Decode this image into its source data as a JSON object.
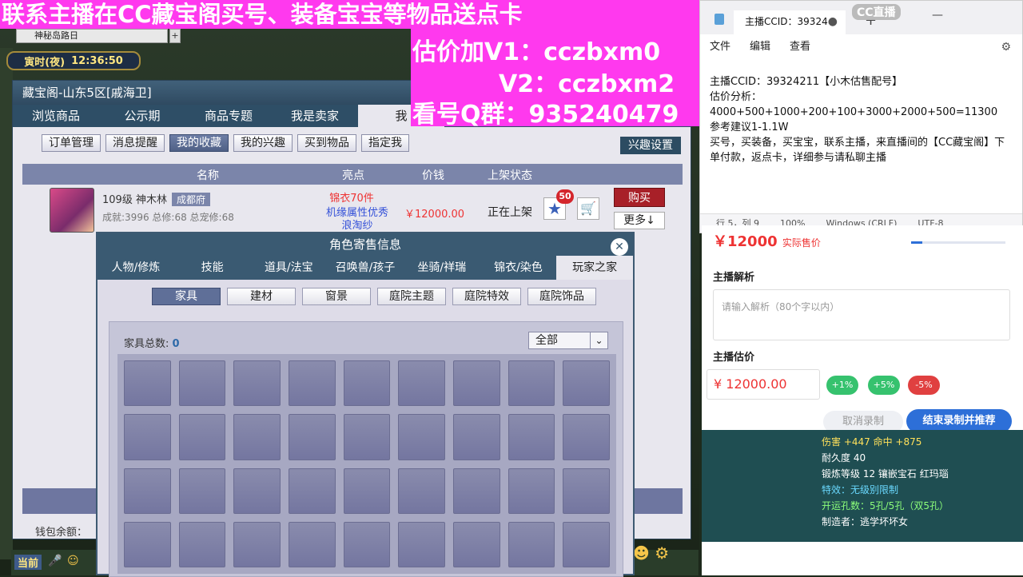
{
  "overlay": {
    "top_text": "联系主播在CC藏宝阁买号、装备宝宝等物品送点卡",
    "v1": "估价加V1：cczbxm0",
    "v2": "V2：cczbxm2",
    "qq": "看号Q群：935240479"
  },
  "game": {
    "clock_label": "寅时(夜)",
    "clock_time": "12:36:50",
    "browser_tab": "神秘岛路日",
    "tab_plus": "+",
    "window_title": "藏宝阁-山东5区[戚海卫]",
    "main_tabs": [
      "浏览商品",
      "公示期",
      "商品专题",
      "我是卖家",
      "我"
    ],
    "sub_tabs": [
      "订单管理",
      "消息提醒",
      "我的收藏",
      "我的兴趣",
      "买到物品",
      "指定我"
    ],
    "interest_btn": "兴趣设置",
    "columns": [
      "名称",
      "亮点",
      "价钱",
      "上架状态"
    ],
    "item": {
      "level_name": "109级 神木林",
      "city": "成都府",
      "stats": "成就:3996 总修:68 总宠修:68",
      "highlight1": "锦衣70件",
      "highlight2": "机缘属性优秀",
      "highlight3": "浪淘纱",
      "price": "￥12000.00",
      "status": "正在上架",
      "star_count": "50",
      "buy": "购买",
      "more": "更多↓"
    },
    "wallet": "钱包余额：",
    "taskbar_current": "当前"
  },
  "popup": {
    "title": "角色寄售信息",
    "close": "✕",
    "tabs": [
      "人物/修炼",
      "技能",
      "道具/法宝",
      "召唤兽/孩子",
      "坐骑/祥瑞",
      "锦衣/染色",
      "玩家之家"
    ],
    "sub_tabs": [
      "家具",
      "建材",
      "窗景",
      "庭院主题",
      "庭院特效",
      "庭院饰品"
    ],
    "count_label": "家具总数:",
    "count_value": "0",
    "filter": "全部",
    "slot_count": 36
  },
  "notepad": {
    "tab_title": "主播CCID：39324",
    "tab_dot": "●",
    "plus": "+",
    "window_controls": "—",
    "watermark": "CC直播",
    "menu": [
      "文件",
      "编辑",
      "查看"
    ],
    "lines": [
      "主播CCID：39324211【小木估售配号】",
      "估价分析：",
      "4000+500+1000+200+100+3000+2000+500=11300",
      "参考建议1-1.1W",
      "买号，买装备，买宝宝，联系主播，来直播间的【CC藏宝阁】下单付款，返点卡，详细参与请私聊主播"
    ],
    "status": [
      "行 5，列 9",
      "100%",
      "Windows (CRLF)",
      "UTF-8"
    ]
  },
  "cc": {
    "price_big": "￥12000",
    "price_note": "实际售价",
    "progress": 0.12,
    "analysis_label": "主播解析",
    "analysis_placeholder": "请输入解析（80个字以内）",
    "estimate_label": "主播估价",
    "estimate_value": "¥ 12000.00",
    "adjust": [
      {
        "label": "+1%",
        "color": "#36c26e"
      },
      {
        "label": "+5%",
        "color": "#36c26e"
      },
      {
        "label": "-5%",
        "color": "#e04040"
      }
    ],
    "cancel": "取消录制",
    "finish": "结束录制并推荐"
  },
  "tooltip": {
    "lines": [
      {
        "text": "伤害 +447 命中 +875",
        "color": "#ffe05a"
      },
      {
        "text": "耐久度 40",
        "color": "#ffffff"
      },
      {
        "text": "锻炼等级 12 镶嵌宝石 红玛瑙",
        "color": "#ffffff"
      },
      {
        "text": "特效：无级别限制",
        "color": "#6ad9ff"
      },
      {
        "text": "开运孔数：5孔/5孔（双5孔）",
        "color": "#8dff7a"
      },
      {
        "text": "制造者：逃学坏坏女 ",
        "color": "#ffffff"
      }
    ]
  }
}
